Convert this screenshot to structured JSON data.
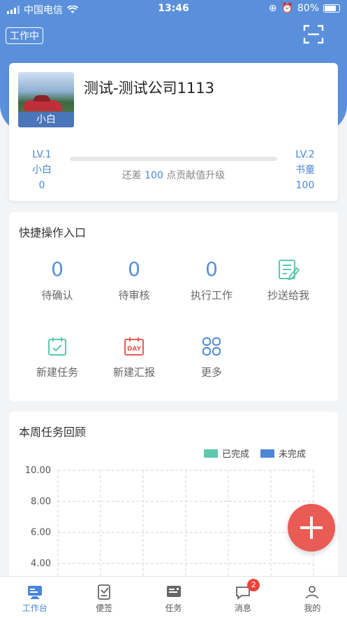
{
  "status_bar": {
    "carrier": "中国电信",
    "time": "13:46",
    "battery": "80%"
  },
  "header": {
    "work_status": "工作中",
    "scan_icon": "scan-icon"
  },
  "profile": {
    "avatar_caption": "小白",
    "company": "测试-测试公司1113",
    "level_current": {
      "lv": "LV.1",
      "title": "小白",
      "points": "0"
    },
    "level_next": {
      "lv": "LV.2",
      "title": "书童",
      "points": "100"
    },
    "progress": 0,
    "upgrade_prefix": "还差",
    "upgrade_points": "100",
    "upgrade_suffix": "点贡献值升级"
  },
  "quick": {
    "title": "快捷操作入口",
    "counters": [
      {
        "value": "0",
        "label": "待确认"
      },
      {
        "value": "0",
        "label": "待审核"
      },
      {
        "value": "0",
        "label": "执行工作"
      }
    ],
    "actions": [
      {
        "label": "抄送给我",
        "icon": "cc-document-icon"
      },
      {
        "label": "新建任务",
        "icon": "calendar-check-icon"
      },
      {
        "label": "新建汇报",
        "icon": "calendar-day-icon",
        "icon_text": "DAY"
      },
      {
        "label": "更多",
        "icon": "grid-more-icon"
      }
    ]
  },
  "weekly": {
    "title": "本周任务回顾",
    "chart_data": {
      "type": "bar",
      "title": "本周任务回顾",
      "series": [
        {
          "name": "已完成",
          "values": [],
          "color": "#5ec7ad"
        },
        {
          "name": "未完成",
          "values": [],
          "color": "#4f86d6"
        }
      ],
      "yticks": [
        "10.00",
        "8.00",
        "6.00",
        "4.00"
      ],
      "ylim": [
        0,
        10
      ],
      "grid": true,
      "legend": "top-right"
    }
  },
  "fab": {
    "icon": "plus-icon"
  },
  "tabbar": {
    "tabs": [
      {
        "label": "工作台",
        "icon": "workbench-icon",
        "active": true
      },
      {
        "label": "便签",
        "icon": "note-icon"
      },
      {
        "label": "任务",
        "icon": "task-icon"
      },
      {
        "label": "消息",
        "icon": "message-icon",
        "badge": "2"
      },
      {
        "label": "我的",
        "icon": "profile-icon"
      }
    ]
  },
  "colors": {
    "primary": "#5a90db",
    "accent_red": "#e95b55",
    "completed": "#5ec7ad",
    "incomplete": "#4f86d6"
  }
}
